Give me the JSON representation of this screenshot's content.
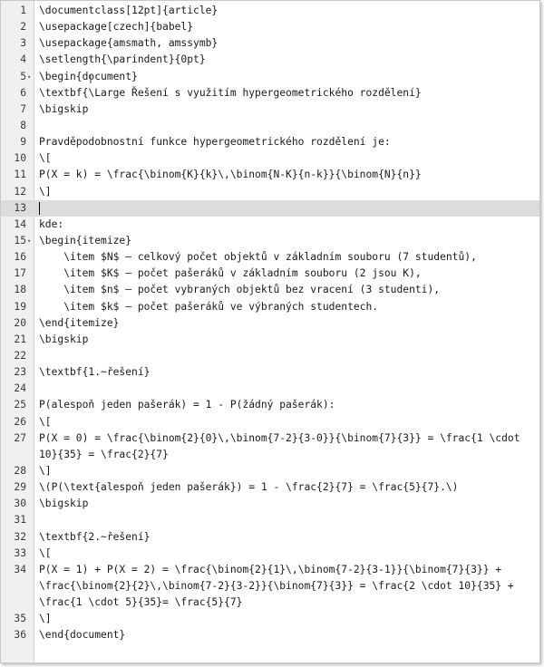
{
  "editor": {
    "lines": [
      {
        "n": "1",
        "t": "\\documentclass[12pt]{article}"
      },
      {
        "n": "2",
        "t": "\\usepackage[czech]{babel}"
      },
      {
        "n": "3",
        "t": "\\usepackage{amsmath, amssymb}"
      },
      {
        "n": "4",
        "t": "\\setlength{\\parindent}{0pt}"
      },
      {
        "n": "5",
        "t": "\\begin{document}",
        "fold": true
      },
      {
        "n": "6",
        "t": "\\textbf{\\Large Řešení s využitím hypergeometrického rozdělení}"
      },
      {
        "n": "7",
        "t": "\\bigskip"
      },
      {
        "n": "8",
        "t": ""
      },
      {
        "n": "9",
        "t": "Pravděpodobnostní funkce hypergeometrického rozdělení je:"
      },
      {
        "n": "10",
        "t": "\\["
      },
      {
        "n": "11",
        "t": "P(X = k) = \\frac{\\binom{K}{k}\\,\\binom{N-K}{n-k}}{\\binom{N}{n}}"
      },
      {
        "n": "12",
        "t": "\\]"
      },
      {
        "n": "13",
        "t": "",
        "current": true
      },
      {
        "n": "14",
        "t": "kde:"
      },
      {
        "n": "15",
        "t": "\\begin{itemize}",
        "fold": true
      },
      {
        "n": "16",
        "t": "    \\item $N$ – celkový počet objektů v základním souboru (7 studentů),"
      },
      {
        "n": "17",
        "t": "    \\item $K$ – počet pašeráků v základním souboru (2 jsou K),"
      },
      {
        "n": "18",
        "t": "    \\item $n$ – počet vybraných objektů bez vracení (3 studenti),"
      },
      {
        "n": "19",
        "t": "    \\item $k$ – počet pašeráků ve výbraných studentech."
      },
      {
        "n": "20",
        "t": "\\end{itemize}"
      },
      {
        "n": "21",
        "t": "\\bigskip"
      },
      {
        "n": "22",
        "t": ""
      },
      {
        "n": "23",
        "t": "\\textbf{1.~řešení}"
      },
      {
        "n": "24",
        "t": ""
      },
      {
        "n": "25",
        "t": "P(alespoň jeden pašerák) = 1 - P(žádný pašerák):"
      },
      {
        "n": "26",
        "t": "\\["
      },
      {
        "n": "27",
        "t": "P(X = 0) = \\frac{\\binom{2}{0}\\,\\binom{7-2}{3-0}}{\\binom{7}{3}} = \\frac{1 \\cdot"
      },
      {
        "n": "",
        "t": "10}{35} = \\frac{2}{7}"
      },
      {
        "n": "28",
        "t": "\\]"
      },
      {
        "n": "29",
        "t": "\\(P(\\text{alespoň jeden pašerák}) = 1 - \\frac{2}{7} = \\frac{5}{7}.\\)"
      },
      {
        "n": "30",
        "t": "\\bigskip"
      },
      {
        "n": "31",
        "t": ""
      },
      {
        "n": "32",
        "t": "\\textbf{2.~řešení}"
      },
      {
        "n": "33",
        "t": "\\["
      },
      {
        "n": "34",
        "t": "P(X = 1) + P(X = 2) = \\frac{\\binom{2}{1}\\,\\binom{7-2}{3-1}}{\\binom{7}{3}} +"
      },
      {
        "n": "",
        "t": "\\frac{\\binom{2}{2}\\,\\binom{7-2}{3-2}}{\\binom{7}{3}} = \\frac{2 \\cdot 10}{35} +"
      },
      {
        "n": "",
        "t": "\\frac{1 \\cdot 5}{35}= \\frac{5}{7}"
      },
      {
        "n": "35",
        "t": "\\]"
      },
      {
        "n": "36",
        "t": "\\end{document}"
      }
    ]
  }
}
